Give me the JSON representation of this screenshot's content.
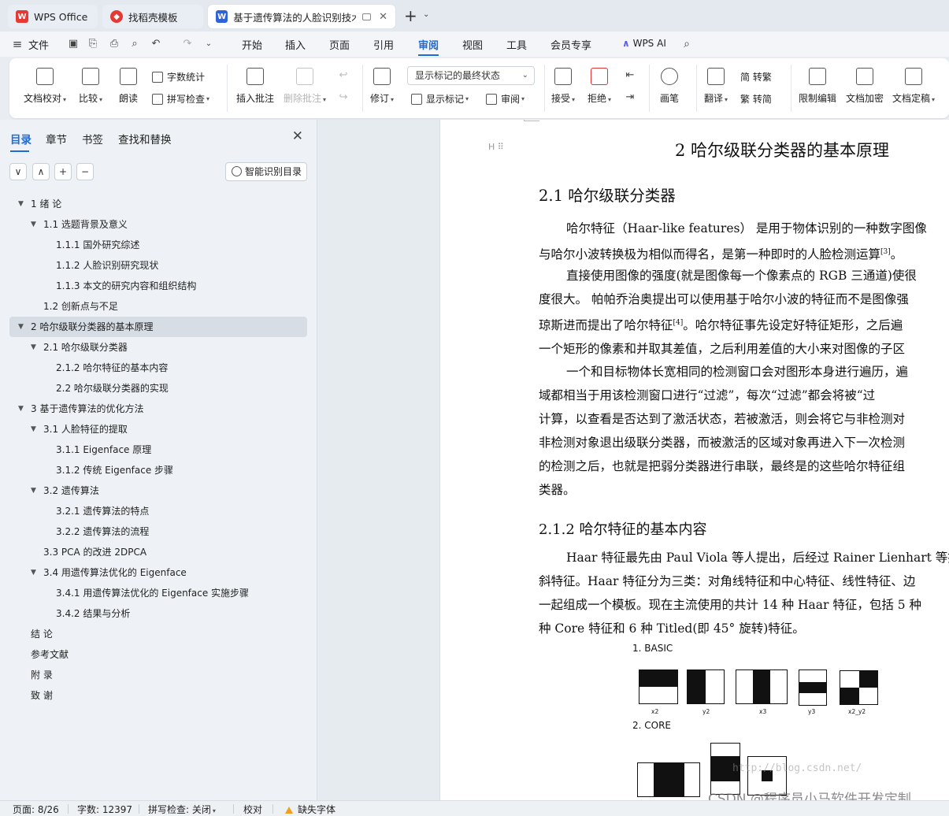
{
  "tabs": [
    {
      "label": "WPS Office",
      "icon": "wps-logo-icon",
      "color": "#e53935"
    },
    {
      "label": "找稻壳模板",
      "icon": "docer-icon",
      "color": "#e53935"
    },
    {
      "label": "基于遗传算法的人脸识别技术",
      "icon": "word-doc-icon",
      "color": "#2f63d6"
    }
  ],
  "menubar": {
    "file": "文件",
    "items": [
      "开始",
      "插入",
      "页面",
      "引用",
      "审阅",
      "视图",
      "工具",
      "会员专享"
    ],
    "active": "审阅",
    "wps_ai": "WPS AI"
  },
  "ribbon": {
    "doc_proofread": "文档校对",
    "compare": "比较",
    "read_aloud": "朗读",
    "word_count": "字数统计",
    "spell_check": "拼写检查",
    "insert_comment": "插入批注",
    "delete_comment": "删除批注",
    "revise": "修订",
    "markup_select": "显示标记的最终状态",
    "show_markup": "显示标记",
    "review": "审阅",
    "accept": "接受",
    "reject": "拒绝",
    "pen": "画笔",
    "translate": "翻译",
    "to_traditional": "简 转繁",
    "to_simplified": "繁 转简",
    "restrict_edit": "限制编辑",
    "doc_encrypt": "文档加密",
    "doc_finalize": "文档定稿"
  },
  "panel": {
    "tabs": [
      "目录",
      "章节",
      "书签",
      "查找和替换"
    ],
    "active_tab": "目录",
    "smart_toc": "智能识别目录",
    "controls": [
      "∨",
      "∧",
      "+",
      "−"
    ]
  },
  "toc": [
    {
      "text": "1 绪 论",
      "level": 0,
      "arrow": true
    },
    {
      "text": "1.1 选题背景及意义",
      "level": 1,
      "arrow": true
    },
    {
      "text": "1.1.1 国外研究综述",
      "level": 2,
      "arrow": false
    },
    {
      "text": "1.1.2 人脸识别研究现状",
      "level": 2,
      "arrow": false
    },
    {
      "text": "1.1.3 本文的研究内容和组织结构",
      "level": 2,
      "arrow": false
    },
    {
      "text": "1.2 创新点与不足",
      "level": 1,
      "arrow": false
    },
    {
      "text": "2 哈尔级联分类器的基本原理",
      "level": 0,
      "arrow": true,
      "selected": true
    },
    {
      "text": "2.1 哈尔级联分类器",
      "level": 1,
      "arrow": true
    },
    {
      "text": "2.1.2 哈尔特征的基本内容",
      "level": 2,
      "arrow": false
    },
    {
      "text": "2.2 哈尔级联分类器的实现",
      "level": 2,
      "arrow": false
    },
    {
      "text": "3 基于遗传算法的优化方法",
      "level": 0,
      "arrow": true
    },
    {
      "text": "3.1 人脸特征的提取",
      "level": 1,
      "arrow": true
    },
    {
      "text": "3.1.1 Eigenface 原理",
      "level": 2,
      "arrow": false
    },
    {
      "text": "3.1.2 传统 Eigenface 步骤",
      "level": 2,
      "arrow": false
    },
    {
      "text": "3.2 遗传算法",
      "level": 1,
      "arrow": true
    },
    {
      "text": "3.2.1 遗传算法的特点",
      "level": 2,
      "arrow": false
    },
    {
      "text": "3.2.2 遗传算法的流程",
      "level": 2,
      "arrow": false
    },
    {
      "text": "3.3 PCA 的改进 2DPCA",
      "level": 1,
      "arrow": false
    },
    {
      "text": "3.4 用遗传算法优化的 Eigenface",
      "level": 1,
      "arrow": true
    },
    {
      "text": "3.4.1 用遗传算法优化的 Eigenface 实施步骤",
      "level": 2,
      "arrow": false
    },
    {
      "text": "3.4.2 结果与分析",
      "level": 2,
      "arrow": false
    },
    {
      "text": "结 论",
      "level": 0,
      "arrow": false
    },
    {
      "text": "参考文献",
      "level": 0,
      "arrow": false
    },
    {
      "text": "附 录",
      "level": 0,
      "arrow": false
    },
    {
      "text": "致 谢",
      "level": 0,
      "arrow": false
    }
  ],
  "doc": {
    "h1": "2 哈尔级联分类器的基本原理",
    "h2_1": "2.1 哈尔级联分类器",
    "p1": [
      "哈尔特征（Haar-like features） 是用于物体识别的一种数字图像",
      "与哈尔小波转换极为相似而得名，是第一种即时的人脸检测运算"
    ],
    "p1_ref": "[3]",
    "p1_end": "。",
    "p2": [
      "直接使用图像的强度(就是图像每一个像素点的 RGB 三通道)使很",
      "度很大。 帕帕乔治奥提出可以使用基于哈尔小波的特征而不是图像强",
      "琼斯进而提出了哈尔特征",
      "一个矩形的像素和并取其差值，之后利用差值的大小来对图像的子区"
    ],
    "p2_ref": "[4]",
    "p2_line3_tail": "。哈尔特征事先设定好特征矩形，之后遍",
    "p3": [
      "一个和目标物体长宽相同的检测窗口会对图形本身进行遍历，遍",
      "域都相当于用该检测窗口进行“过滤”，每次“过滤”都会将被“过",
      "计算，以查看是否达到了激活状态，若被激活，则会将它与非检测对",
      "非检测对象退出级联分类器，而被激活的区域对象再进入下一次检测",
      "的检测之后，也就是把弱分类器进行串联，最终是的这些哈尔特征组",
      "类器。"
    ],
    "h3_1": "2.1.2 哈尔特征的基本内容",
    "p4": [
      "Haar 特征最先由 Paul Viola 等人提出，后经过 Rainer Lienhart 等提",
      "斜特征。Haar 特征分为三类：对角线特征和中心特征、线性特征、边",
      "一起组成一个模板。现在主流使用的共计 14 种 Haar 特征，包括 5 种",
      "种 Core 特征和 6 种 Titled(即 45° 旋转)特征。"
    ],
    "fig_basic": "1. BASIC",
    "fig_core": "2. CORE",
    "fig_captions": [
      "x2",
      "y2",
      "x3",
      "y3",
      "x2_y2"
    ],
    "watermark": "http://blog.csdn.net/",
    "wm_csdn": "CSDN @程序员小马软件开发定制"
  },
  "status": {
    "page": "页面: 8/26",
    "words": "字数: 12397",
    "spell": "拼写检查: 关闭",
    "proof": "校对",
    "missing_font": "缺失字体"
  },
  "colors": {
    "accent": "#1f6bd9",
    "selected_row": "#d7dde5"
  }
}
